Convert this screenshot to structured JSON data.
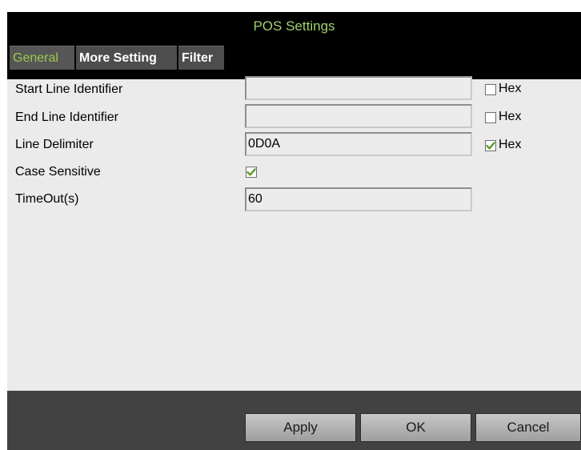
{
  "window": {
    "title": "POS Settings"
  },
  "tabs": [
    {
      "label": "General"
    },
    {
      "label": "More Setting"
    },
    {
      "label": "Filter"
    }
  ],
  "form": {
    "start_line_identifier": {
      "label": "Start Line Identifier",
      "value": "",
      "hex_label": "Hex",
      "hex_checked": false
    },
    "end_line_identifier": {
      "label": "End Line Identifier",
      "value": "",
      "hex_label": "Hex",
      "hex_checked": false
    },
    "line_delimiter": {
      "label": "Line Delimiter",
      "value": "0D0A",
      "hex_label": "Hex",
      "hex_checked": true
    },
    "case_sensitive": {
      "label": "Case Sensitive",
      "checked": true
    },
    "timeout": {
      "label": "TimeOut(s)",
      "value": "60"
    }
  },
  "buttons": {
    "apply": "Apply",
    "ok": "OK",
    "cancel": "Cancel"
  },
  "colors": {
    "title_text": "#a3d16e",
    "active_tab_text": "#9bc94f",
    "check_mark": "#5a9a2a"
  }
}
